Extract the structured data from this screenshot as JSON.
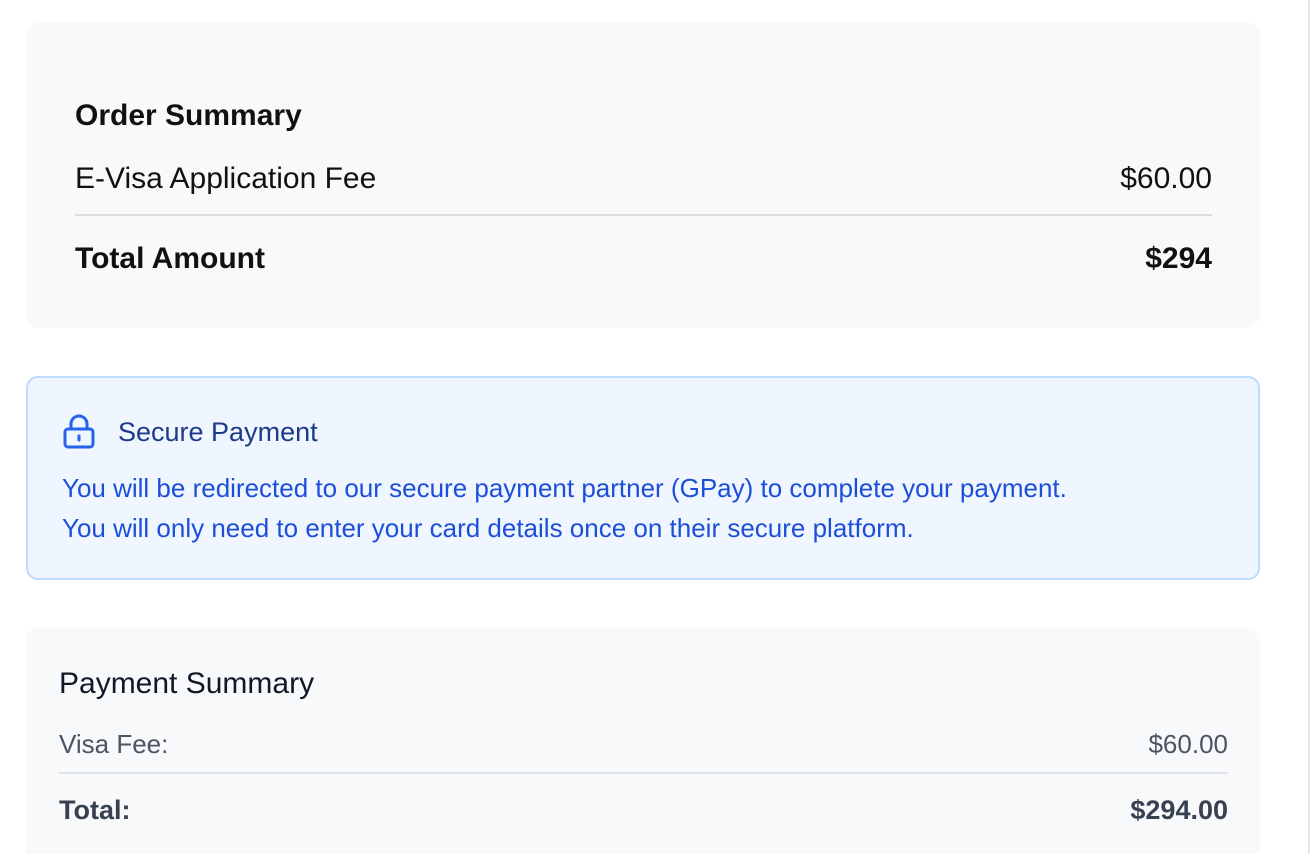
{
  "order_summary": {
    "title": "Order Summary",
    "items": [
      {
        "label": "E-Visa Application Fee",
        "amount": "$60.00"
      }
    ],
    "total_label": "Total Amount",
    "total_amount": "$294"
  },
  "secure_payment": {
    "icon": "lock-icon",
    "title": "Secure Payment",
    "lines": [
      "You will be redirected to our secure payment partner (GPay) to complete your payment.",
      "You will only need to enter your card details once on their secure platform."
    ]
  },
  "payment_summary": {
    "title": "Payment Summary",
    "items": [
      {
        "label": "Visa Fee:",
        "amount": "$60.00"
      }
    ],
    "total_label": "Total:",
    "total_amount": "$294.00"
  },
  "colors": {
    "notice_background": "#eff6ff",
    "notice_border": "#bfdbfe",
    "notice_text": "#1d4ed8",
    "notice_title": "#1e3a8a",
    "card_background": "#f9f9f9"
  }
}
